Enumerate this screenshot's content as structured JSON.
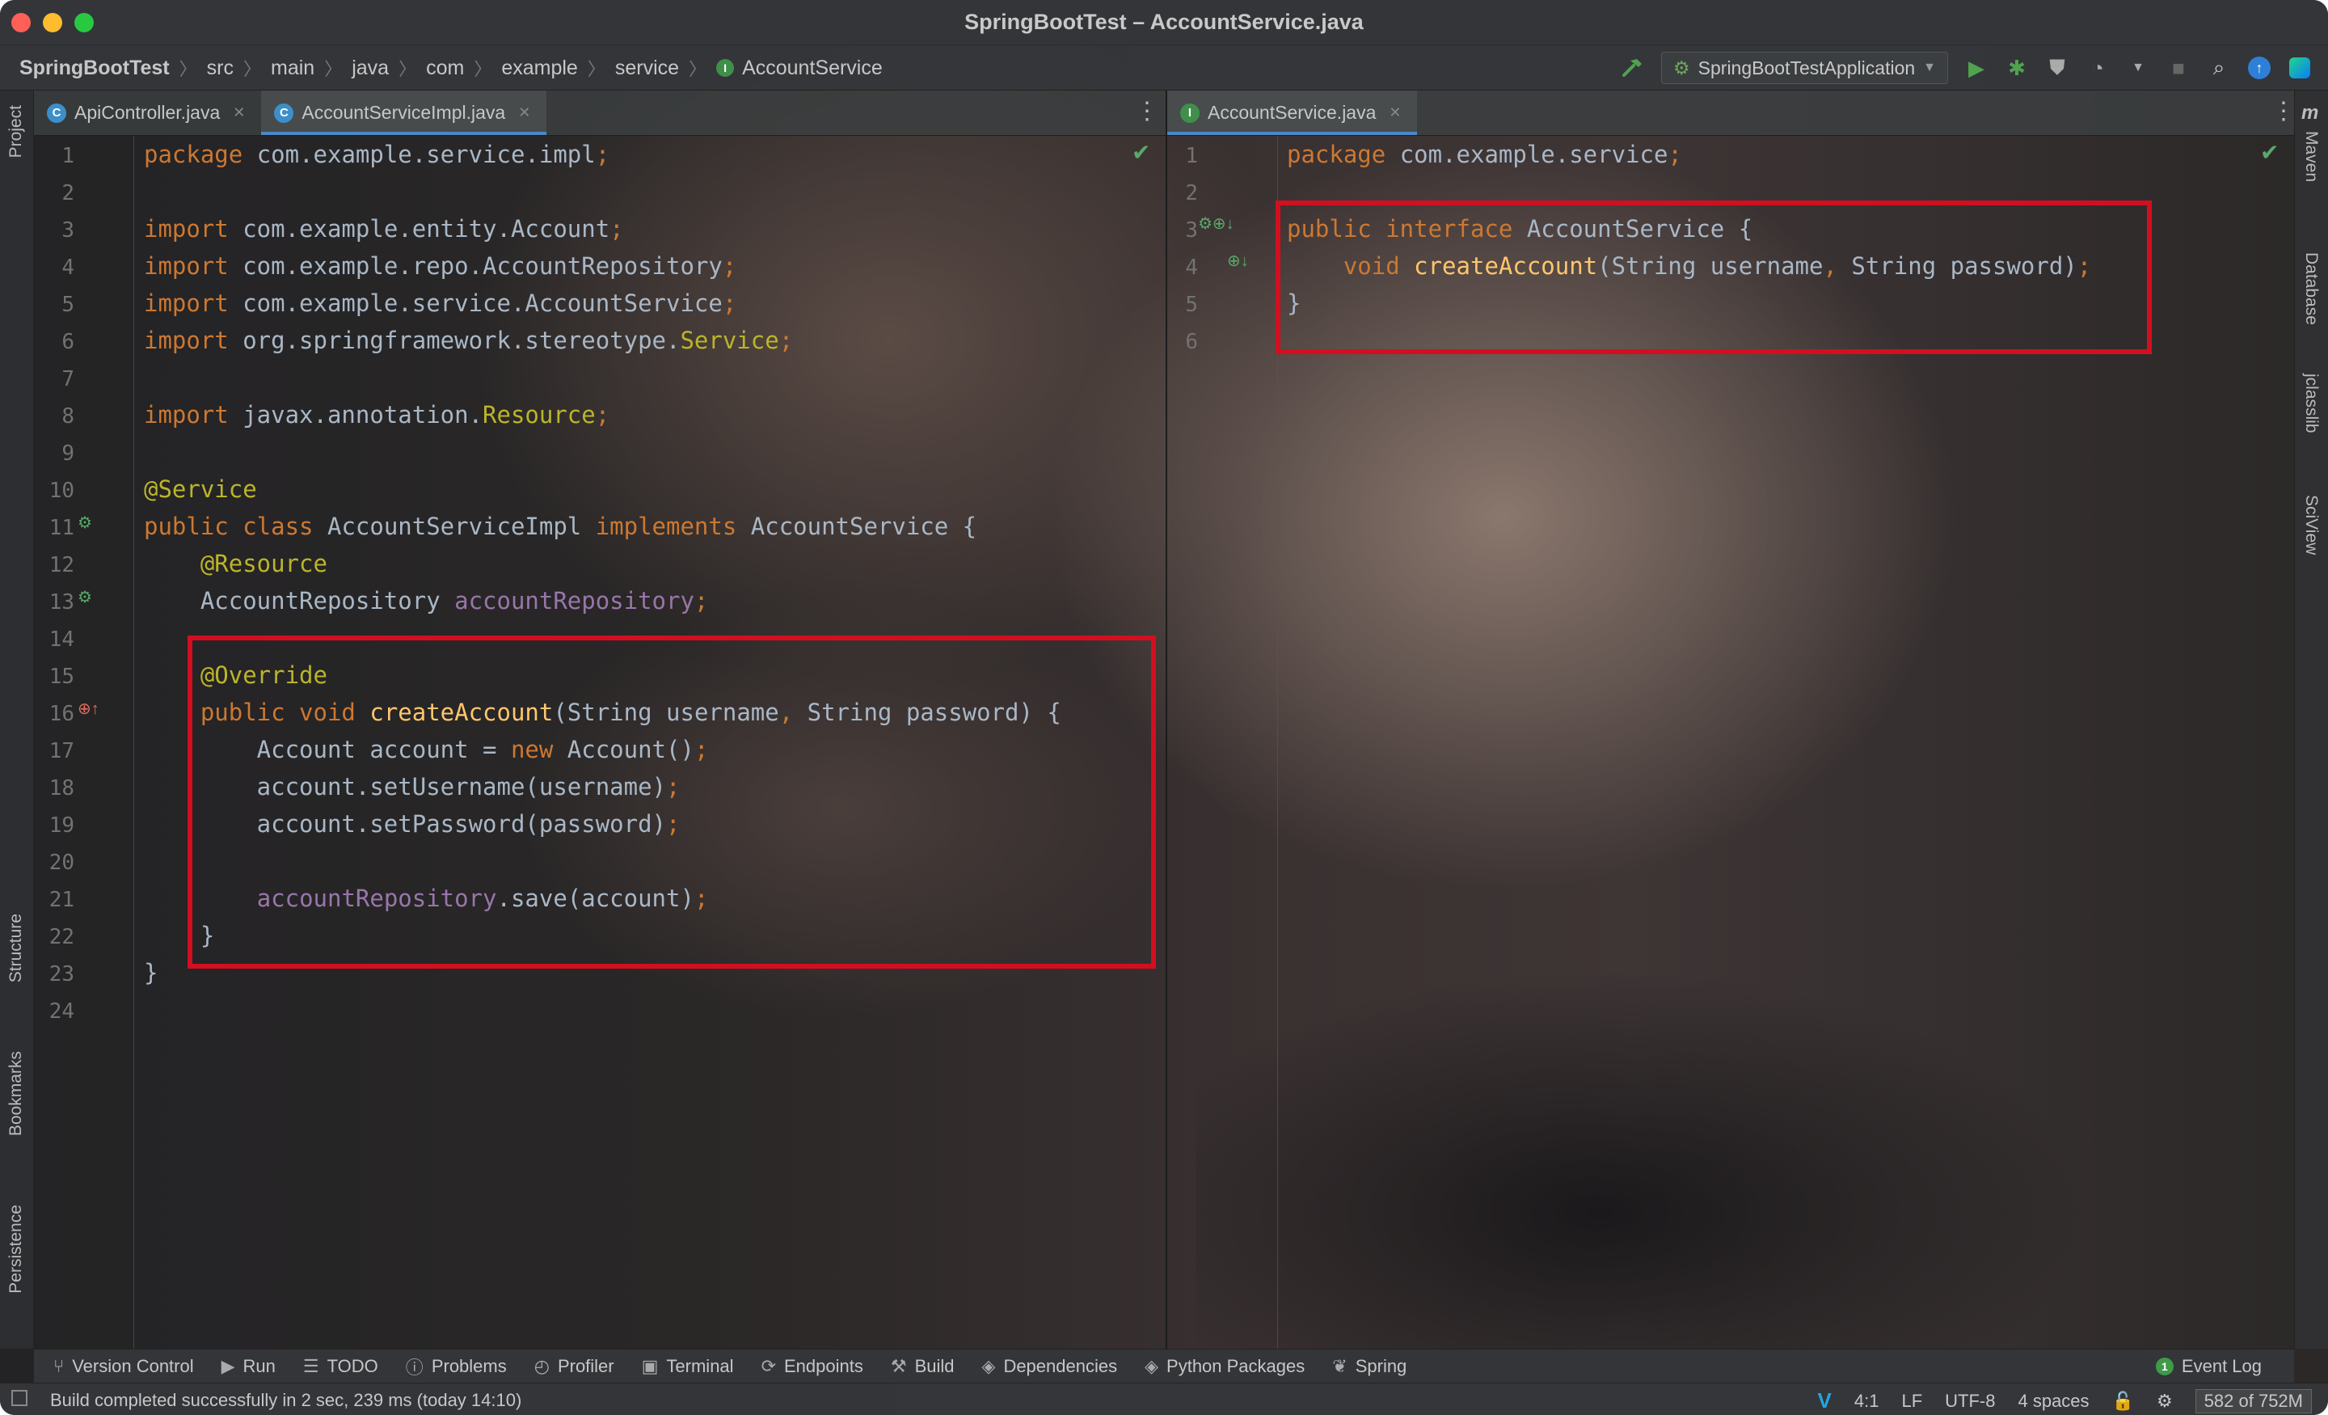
{
  "window": {
    "title": "SpringBootTest – AccountService.java"
  },
  "breadcrumb": [
    "SpringBootTest",
    "src",
    "main",
    "java",
    "com",
    "example",
    "service",
    "AccountService"
  ],
  "toolbar": {
    "run_config": "SpringBootTestApplication"
  },
  "left_strip": {
    "project": "Project",
    "structure": "Structure",
    "bookmarks": "Bookmarks",
    "persistence": "Persistence"
  },
  "right_strip": {
    "maven": "Maven",
    "database": "Database",
    "jclasslib": "jclasslib",
    "sciview": "SciView"
  },
  "left_pane": {
    "tabs": [
      {
        "label": "ApiController.java",
        "badge": "C"
      },
      {
        "label": "AccountServiceImpl.java",
        "badge": "C"
      }
    ],
    "line_numbers": [
      "1",
      "2",
      "3",
      "4",
      "5",
      "6",
      "7",
      "8",
      "9",
      "10",
      "11",
      "12",
      "13",
      "14",
      "15",
      "16",
      "17",
      "18",
      "19",
      "20",
      "21",
      "22",
      "23",
      "24"
    ],
    "code": [
      [
        {
          "t": "package ",
          "c": "kw"
        },
        {
          "t": "com.example.service.impl",
          "c": "plain"
        },
        {
          "t": ";",
          "c": "kw"
        }
      ],
      [],
      [
        {
          "t": "import ",
          "c": "kw"
        },
        {
          "t": "com.example.entity.Account",
          "c": "plain"
        },
        {
          "t": ";",
          "c": "kw"
        }
      ],
      [
        {
          "t": "import ",
          "c": "kw"
        },
        {
          "t": "com.example.repo.AccountRepository",
          "c": "plain"
        },
        {
          "t": ";",
          "c": "kw"
        }
      ],
      [
        {
          "t": "import ",
          "c": "kw"
        },
        {
          "t": "com.example.service.AccountService",
          "c": "plain"
        },
        {
          "t": ";",
          "c": "kw"
        }
      ],
      [
        {
          "t": "import ",
          "c": "kw"
        },
        {
          "t": "org.springframework.stereotype.",
          "c": "plain"
        },
        {
          "t": "Service",
          "c": "ann"
        },
        {
          "t": ";",
          "c": "kw"
        }
      ],
      [],
      [
        {
          "t": "import ",
          "c": "kw"
        },
        {
          "t": "javax.annotation.",
          "c": "plain"
        },
        {
          "t": "Resource",
          "c": "ann"
        },
        {
          "t": ";",
          "c": "kw"
        }
      ],
      [],
      [
        {
          "t": "@Service",
          "c": "ann"
        }
      ],
      [
        {
          "t": "public class ",
          "c": "kw"
        },
        {
          "t": "AccountServiceImpl ",
          "c": "plain"
        },
        {
          "t": "implements ",
          "c": "kw"
        },
        {
          "t": "AccountService {",
          "c": "plain"
        }
      ],
      [
        {
          "t": "    @Resource",
          "c": "ann"
        }
      ],
      [
        {
          "t": "    AccountRepository ",
          "c": "plain"
        },
        {
          "t": "accountRepository",
          "c": "field"
        },
        {
          "t": ";",
          "c": "kw"
        }
      ],
      [],
      [
        {
          "t": "    @Override",
          "c": "ann"
        }
      ],
      [
        {
          "t": "    public void ",
          "c": "kw"
        },
        {
          "t": "createAccount",
          "c": "method"
        },
        {
          "t": "(String username",
          "c": "plain"
        },
        {
          "t": ", ",
          "c": "kw"
        },
        {
          "t": "String password) {",
          "c": "plain"
        }
      ],
      [
        {
          "t": "        Account account = ",
          "c": "plain"
        },
        {
          "t": "new ",
          "c": "kw"
        },
        {
          "t": "Account()",
          "c": "plain"
        },
        {
          "t": ";",
          "c": "kw"
        }
      ],
      [
        {
          "t": "        account.setUsername(username)",
          "c": "plain"
        },
        {
          "t": ";",
          "c": "kw"
        }
      ],
      [
        {
          "t": "        account.setPassword(password)",
          "c": "plain"
        },
        {
          "t": ";",
          "c": "kw"
        }
      ],
      [],
      [
        {
          "t": "        ",
          "c": "plain"
        },
        {
          "t": "accountRepository",
          "c": "field"
        },
        {
          "t": ".save(account)",
          "c": "plain"
        },
        {
          "t": ";",
          "c": "kw"
        }
      ],
      [
        {
          "t": "    }",
          "c": "plain"
        }
      ],
      [
        {
          "t": "}",
          "c": "plain"
        }
      ],
      []
    ]
  },
  "right_pane": {
    "tabs": [
      {
        "label": "AccountService.java",
        "badge": "I"
      }
    ],
    "line_numbers": [
      "1",
      "2",
      "3",
      "4",
      "5",
      "6"
    ],
    "code": [
      [
        {
          "t": "package ",
          "c": "kw"
        },
        {
          "t": "com.example.service",
          "c": "plain"
        },
        {
          "t": ";",
          "c": "kw"
        }
      ],
      [],
      [
        {
          "t": "public interface ",
          "c": "kw"
        },
        {
          "t": "AccountService {",
          "c": "plain"
        }
      ],
      [
        {
          "t": "    void ",
          "c": "kw"
        },
        {
          "t": "createAccount",
          "c": "method"
        },
        {
          "t": "(String username",
          "c": "plain"
        },
        {
          "t": ", ",
          "c": "kw"
        },
        {
          "t": "String password)",
          "c": "plain"
        },
        {
          "t": ";",
          "c": "kw"
        }
      ],
      [
        {
          "t": "}",
          "c": "plain"
        }
      ],
      []
    ]
  },
  "tool_windows": [
    "Version Control",
    "Run",
    "TODO",
    "Problems",
    "Profiler",
    "Terminal",
    "Endpoints",
    "Build",
    "Dependencies",
    "Python Packages",
    "Spring"
  ],
  "event_log": {
    "label": "Event Log",
    "count": "1"
  },
  "status": {
    "message": "Build completed successfully in 2 sec, 239 ms (today 14:10)",
    "position": "4:1",
    "line_sep": "LF",
    "encoding": "UTF-8",
    "indent": "4 spaces",
    "memory": "582 of 752M"
  },
  "colors": {
    "kw": "#cc7832",
    "plain": "#a9b7c6",
    "ann": "#bbb529",
    "field": "#9876aa",
    "method": "#ffc66d",
    "highlight_box": "#d30f1f",
    "tab_underline": "#4a88c7"
  }
}
